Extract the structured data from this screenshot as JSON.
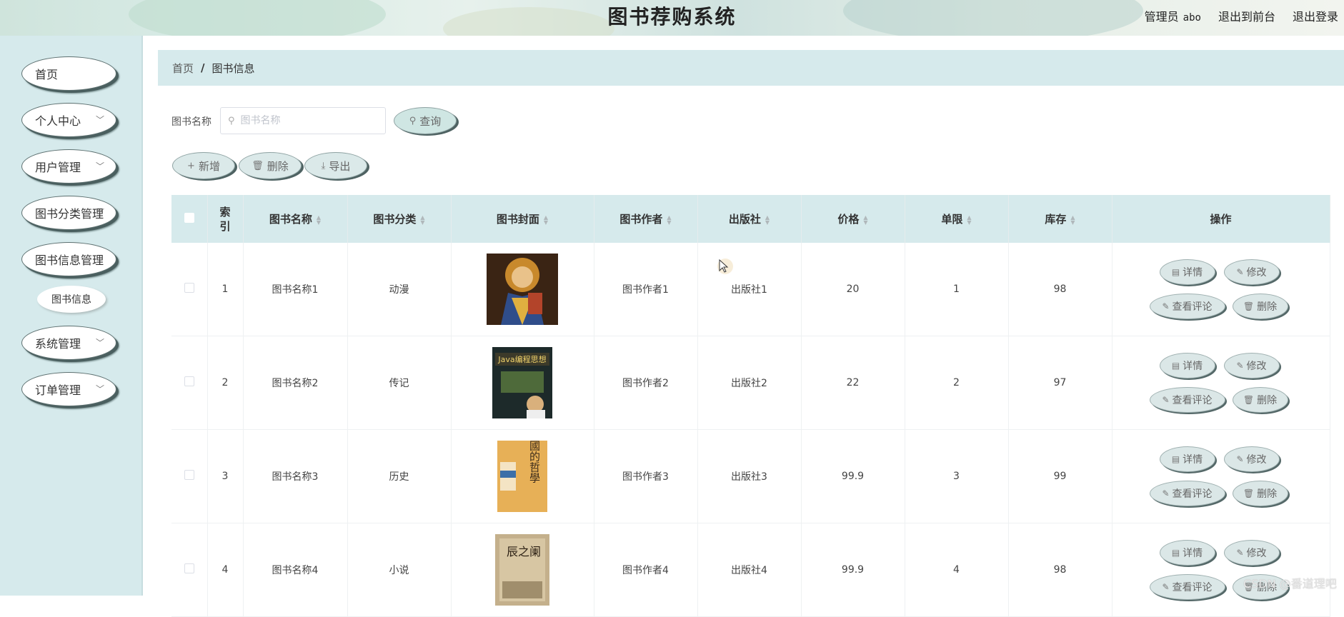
{
  "header": {
    "title": "图书荐购系统",
    "role_label": "管理员",
    "username": "abo",
    "back_label": "退出到前台",
    "logout_label": "退出登录"
  },
  "sidebar": {
    "items": [
      {
        "label": "首页",
        "has_arrow": false
      },
      {
        "label": "个人中心",
        "has_arrow": true
      },
      {
        "label": "用户管理",
        "has_arrow": true
      },
      {
        "label": "图书分类管理",
        "has_arrow": true
      },
      {
        "label": "图书信息管理",
        "has_arrow": false
      },
      {
        "label": "系统管理",
        "has_arrow": true
      },
      {
        "label": "订单管理",
        "has_arrow": true
      }
    ],
    "sub_item": "图书信息"
  },
  "breadcrumb": {
    "home": "首页",
    "separator": "/",
    "current": "图书信息"
  },
  "search": {
    "label": "图书名称",
    "placeholder": "图书名称",
    "value": "",
    "button_label": "查询"
  },
  "toolbar": {
    "add_label": "新增",
    "delete_label": "删除",
    "export_label": "导出"
  },
  "table": {
    "columns": [
      "索引",
      "图书名称",
      "图书分类",
      "图书封面",
      "图书作者",
      "出版社",
      "价格",
      "单限",
      "库存",
      "操作"
    ],
    "rows": [
      {
        "index": "1",
        "name": "图书名称1",
        "category": "动漫",
        "author": "图书作者1",
        "publisher": "出版社1",
        "price": "20",
        "limit": "1",
        "stock": "98",
        "cover_text": ""
      },
      {
        "index": "2",
        "name": "图书名称2",
        "category": "传记",
        "author": "图书作者2",
        "publisher": "出版社2",
        "price": "22",
        "limit": "2",
        "stock": "97",
        "cover_text": "Java编程思想"
      },
      {
        "index": "3",
        "name": "图书名称3",
        "category": "历史",
        "author": "图书作者3",
        "publisher": "出版社3",
        "price": "99.9",
        "limit": "3",
        "stock": "99",
        "cover_text": "中國的哲學"
      },
      {
        "index": "4",
        "name": "图书名称4",
        "category": "小说",
        "author": "图书作者4",
        "publisher": "出版社4",
        "price": "99.9",
        "limit": "4",
        "stock": "98",
        "cover_text": "辰之阑"
      }
    ],
    "actions": {
      "detail": "详情",
      "edit": "修改",
      "comments": "查看评论",
      "delete": "删除"
    }
  },
  "watermark": "CSDN @番道理吧",
  "colors": {
    "sidebar_bg": "#d6eaec",
    "header_bg": "#d8ebe6",
    "button_bg": "#dbe7e7"
  }
}
